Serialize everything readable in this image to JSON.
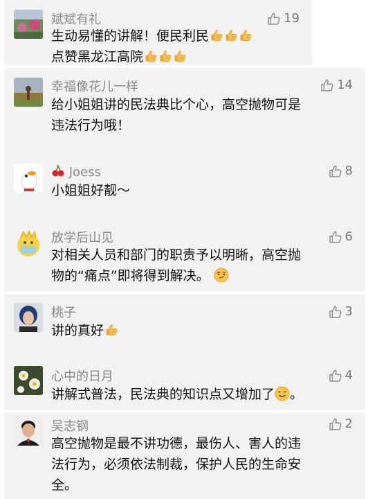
{
  "comments": [
    {
      "name": "斌斌有礼",
      "likes": "19",
      "lines": [
        "生动易懂的讲解！便民利民",
        "点赞黑龙江高院"
      ]
    },
    {
      "name": "幸福像花儿一样",
      "likes": "14",
      "lines": [
        "给小姐姐讲的民法典比个心，高空抛物可是",
        "违法行为哦！"
      ]
    },
    {
      "name": "Joess",
      "likes": "8",
      "lines": [
        "小姐姐好靓～"
      ]
    },
    {
      "name": "放学后山见",
      "likes": "6",
      "lines": [
        "对相关人员和部门的职责予以明晰，高空抛",
        "物的“痛点”即将得到解决。"
      ]
    },
    {
      "name": "桃子",
      "likes": "3",
      "lines": [
        "讲的真好"
      ]
    },
    {
      "name": "心中的日月",
      "likes": "4",
      "lines": [
        "讲解式普法，民法典的知识点又增加了",
        "。"
      ]
    },
    {
      "name": "吴志钢",
      "likes": "2",
      "lines": [
        "高空抛物是最不讲功德，最伤人、害人的违",
        "法行为，必须依法制裁，保护人民的生命安",
        "全。"
      ]
    }
  ],
  "colors": {
    "block_bg": "#f2f2f2",
    "name": "#8a8a8a",
    "text": "#111111"
  },
  "icons": {
    "like": "thumb-up-outline-icon",
    "inline_like": "thumbs-up-emoji-icon",
    "cherry": "cherry-icon",
    "smirk": "smirk-face-icon",
    "smile": "smile-face-icon"
  }
}
